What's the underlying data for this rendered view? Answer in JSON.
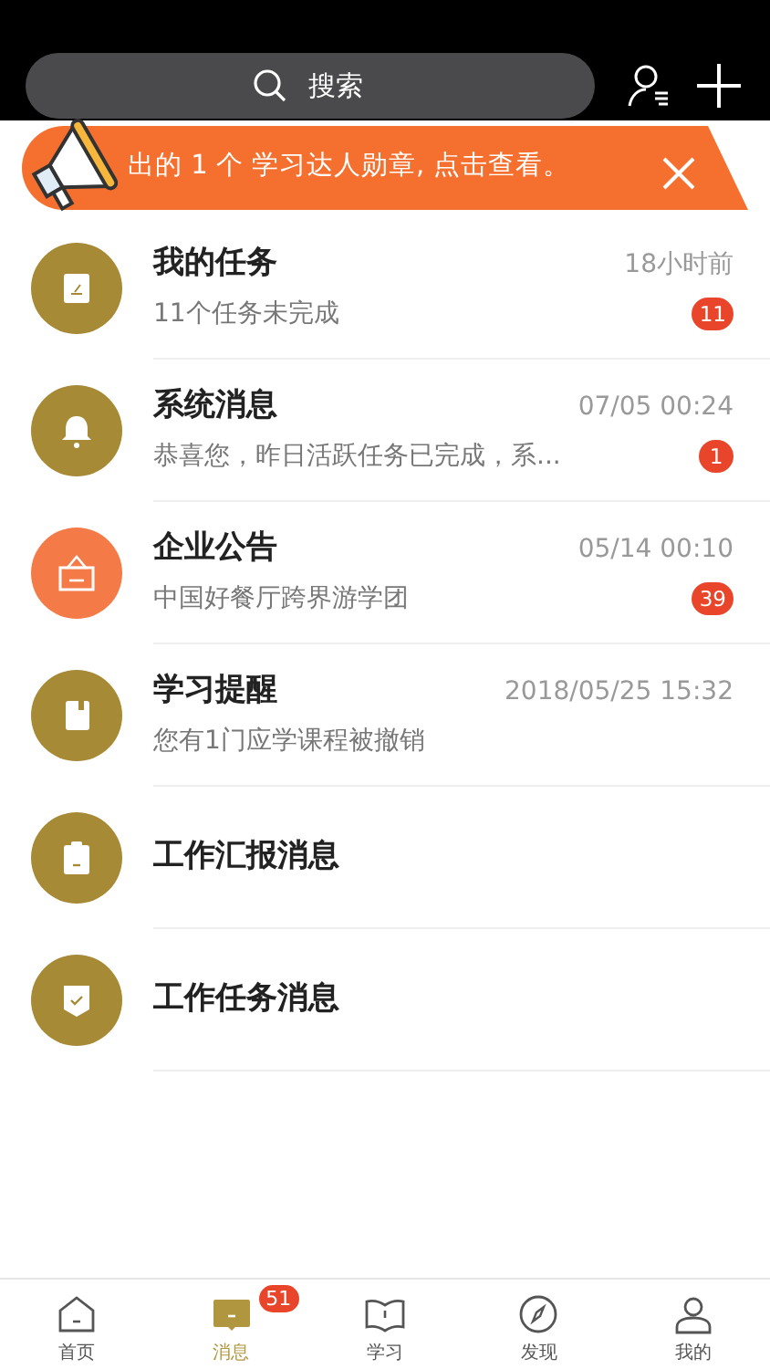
{
  "search": {
    "placeholder": "搜索"
  },
  "banner": {
    "text": "出的 1 个 学习达人勋章, 点击查看。"
  },
  "messages": [
    {
      "title": "我的任务",
      "time": "18小时前",
      "preview": "11个任务未完成",
      "badge": "11",
      "color": "#a78a35"
    },
    {
      "title": "系统消息",
      "time": "07/05 00:24",
      "preview": "恭喜您，昨日活跃任务已完成，系...",
      "badge": "1",
      "color": "#a78a35"
    },
    {
      "title": "企业公告",
      "time": "05/14 00:10",
      "preview": "中国好餐厅跨界游学团",
      "badge": "39",
      "color": "#f47b48"
    },
    {
      "title": "学习提醒",
      "time": "2018/05/25 15:32",
      "preview": "您有1门应学课程被撤销",
      "color": "#a78a35"
    },
    {
      "title": "工作汇报消息",
      "color": "#a78a35"
    },
    {
      "title": "工作任务消息",
      "color": "#a78a35"
    }
  ],
  "tabs": [
    {
      "label": "首页",
      "selected": false
    },
    {
      "label": "消息",
      "selected": true,
      "badge": "51"
    },
    {
      "label": "学习",
      "selected": false
    },
    {
      "label": "发现",
      "selected": false
    },
    {
      "label": "我的",
      "selected": false
    }
  ]
}
